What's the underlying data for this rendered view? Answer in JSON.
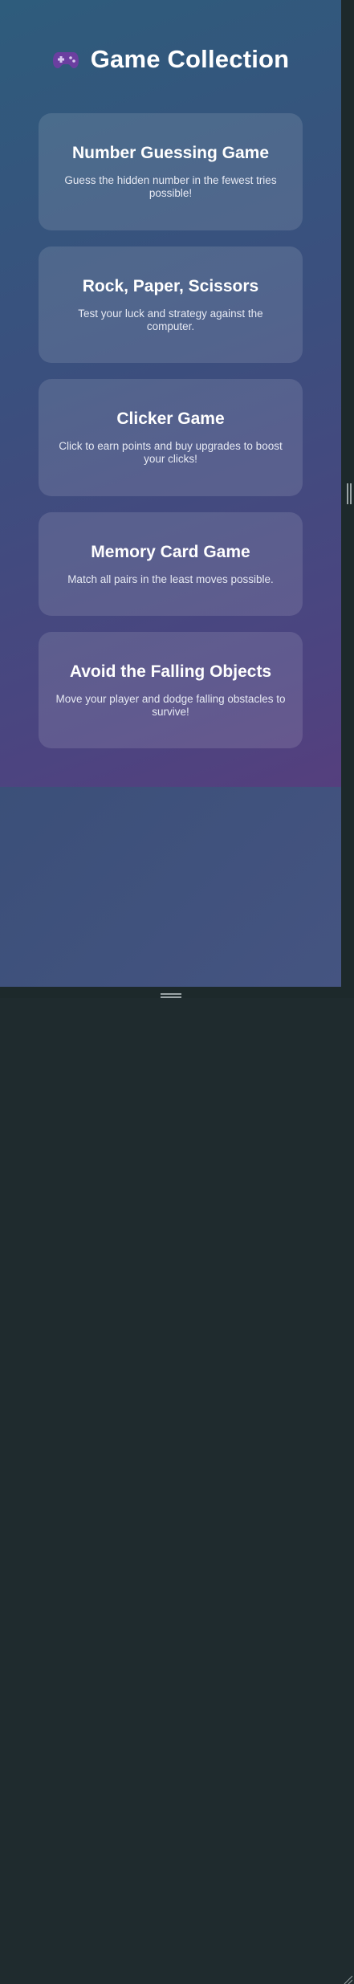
{
  "header": {
    "icon": "gamepad-icon",
    "title": "Game Collection"
  },
  "games": [
    {
      "title": "Number Guessing Game",
      "description": "Guess the hidden number in the fewest tries possible!"
    },
    {
      "title": "Rock, Paper, Scissors",
      "description": "Test your luck and strategy against the computer."
    },
    {
      "title": "Clicker Game",
      "description": "Click to earn points and buy upgrades to boost your clicks!"
    },
    {
      "title": "Memory Card Game",
      "description": "Match all pairs in the least moves possible."
    },
    {
      "title": "Avoid the Falling Objects",
      "description": "Move your player and dodge falling obstacles to survive!"
    }
  ],
  "colors": {
    "text": "#ffffff",
    "card_background": "rgba(255,255,255,0.12)",
    "gradient_start": "#2e5c7c",
    "gradient_end": "#553f7e",
    "icon": "#6b3fa0"
  }
}
